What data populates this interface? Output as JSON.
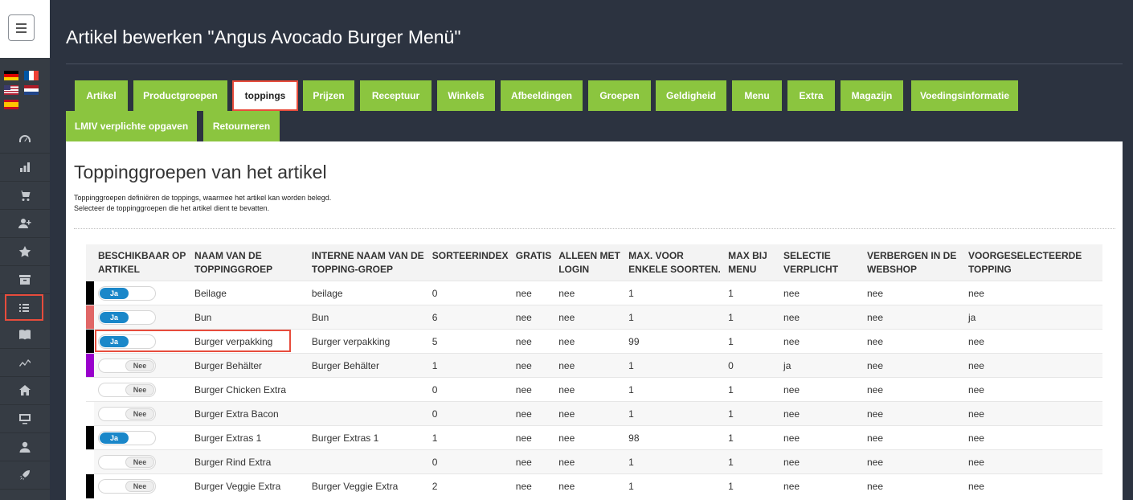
{
  "page": {
    "title": "Artikel bewerken \"Angus Avocado Burger Menü\""
  },
  "sidebar": {
    "flags": [
      "flag-de-icon",
      "flag-fr-icon",
      "flag-us-icon",
      "flag-nl-icon",
      "flag-es-icon"
    ],
    "nav": [
      "dashboard-icon",
      "chart-icon",
      "cart-icon",
      "add-user-icon",
      "star-icon",
      "archive-icon",
      "list-icon",
      "book-icon",
      "trend-icon",
      "home-icon",
      "monitor-icon",
      "user-icon",
      "rocket-icon"
    ],
    "active_index": 6
  },
  "tabs": [
    {
      "label": "Artikel"
    },
    {
      "label": "Productgroepen"
    },
    {
      "label": "toppings"
    },
    {
      "label": "Prijzen"
    },
    {
      "label": "Receptuur"
    },
    {
      "label": "Winkels"
    },
    {
      "label": "Afbeeldingen"
    },
    {
      "label": "Groepen"
    },
    {
      "label": "Geldigheid"
    },
    {
      "label": "Menu"
    },
    {
      "label": "Extra"
    },
    {
      "label": "Magazijn"
    },
    {
      "label": "Voedingsinformatie"
    },
    {
      "label": "LMIV verplichte opgaven"
    },
    {
      "label": "Retourneren"
    }
  ],
  "active_tab": "toppings",
  "section": {
    "title": "Toppinggroepen van het artikel",
    "desc_line1": "Toppinggroepen definiëren de toppings, waarmee het artikel kan worden belegd.",
    "desc_line2": "Selecteer de toppinggroepen die het artikel dient te bevatten."
  },
  "table": {
    "headers": [
      "BESCHIKBAAR OP ARTIKEL",
      "NAAM VAN DE TOPPINGGROEP",
      "INTERNE NAAM VAN DE TOPPING-GROEP",
      "SORTEERINDEX",
      "GRATIS",
      "ALLEEN MET LOGIN",
      "MAX. VOOR ENKELE SOORTEN.",
      "MAX BIJ MENU",
      "SELECTIE VERPLICHT",
      "VERBERGEN IN DE WEBSHOP",
      "VOORGESELECTEERDE TOPPING"
    ],
    "rows": [
      {
        "color": "#000000",
        "available": "Ja",
        "name": "Beilage",
        "internal": "beilage",
        "sort": "0",
        "gratis": "nee",
        "login": "nee",
        "max_single": "1",
        "max_menu": "1",
        "required": "nee",
        "hidden": "nee",
        "preselected": "nee"
      },
      {
        "color": "#e06666",
        "available": "Ja",
        "name": "Bun",
        "internal": "Bun",
        "sort": "6",
        "gratis": "nee",
        "login": "nee",
        "max_single": "1",
        "max_menu": "1",
        "required": "nee",
        "hidden": "nee",
        "preselected": "ja"
      },
      {
        "color": "#000000",
        "available": "Ja",
        "name": "Burger verpakking",
        "internal": "Burger verpakking",
        "sort": "5",
        "gratis": "nee",
        "login": "nee",
        "max_single": "99",
        "max_menu": "1",
        "required": "nee",
        "hidden": "nee",
        "preselected": "nee"
      },
      {
        "color": "#9900cc",
        "available": "Nee",
        "name": "Burger Behälter",
        "internal": "Burger Behälter",
        "sort": "1",
        "gratis": "nee",
        "login": "nee",
        "max_single": "1",
        "max_menu": "0",
        "required": "ja",
        "hidden": "nee",
        "preselected": "nee"
      },
      {
        "color": "",
        "available": "Nee",
        "name": "Burger Chicken Extra",
        "internal": "",
        "sort": "0",
        "gratis": "nee",
        "login": "nee",
        "max_single": "1",
        "max_menu": "1",
        "required": "nee",
        "hidden": "nee",
        "preselected": "nee"
      },
      {
        "color": "",
        "available": "Nee",
        "name": "Burger Extra Bacon",
        "internal": "",
        "sort": "0",
        "gratis": "nee",
        "login": "nee",
        "max_single": "1",
        "max_menu": "1",
        "required": "nee",
        "hidden": "nee",
        "preselected": "nee"
      },
      {
        "color": "#000000",
        "available": "Ja",
        "name": "Burger Extras 1",
        "internal": "Burger Extras 1",
        "sort": "1",
        "gratis": "nee",
        "login": "nee",
        "max_single": "98",
        "max_menu": "1",
        "required": "nee",
        "hidden": "nee",
        "preselected": "nee"
      },
      {
        "color": "",
        "available": "Nee",
        "name": "Burger Rind Extra",
        "internal": "",
        "sort": "0",
        "gratis": "nee",
        "login": "nee",
        "max_single": "1",
        "max_menu": "1",
        "required": "nee",
        "hidden": "nee",
        "preselected": "nee"
      },
      {
        "color": "#000000",
        "available": "Nee",
        "name": "Burger Veggie Extra",
        "internal": "Burger Veggie Extra",
        "sort": "2",
        "gratis": "nee",
        "login": "nee",
        "max_single": "1",
        "max_menu": "1",
        "required": "nee",
        "hidden": "nee",
        "preselected": "nee"
      }
    ]
  }
}
